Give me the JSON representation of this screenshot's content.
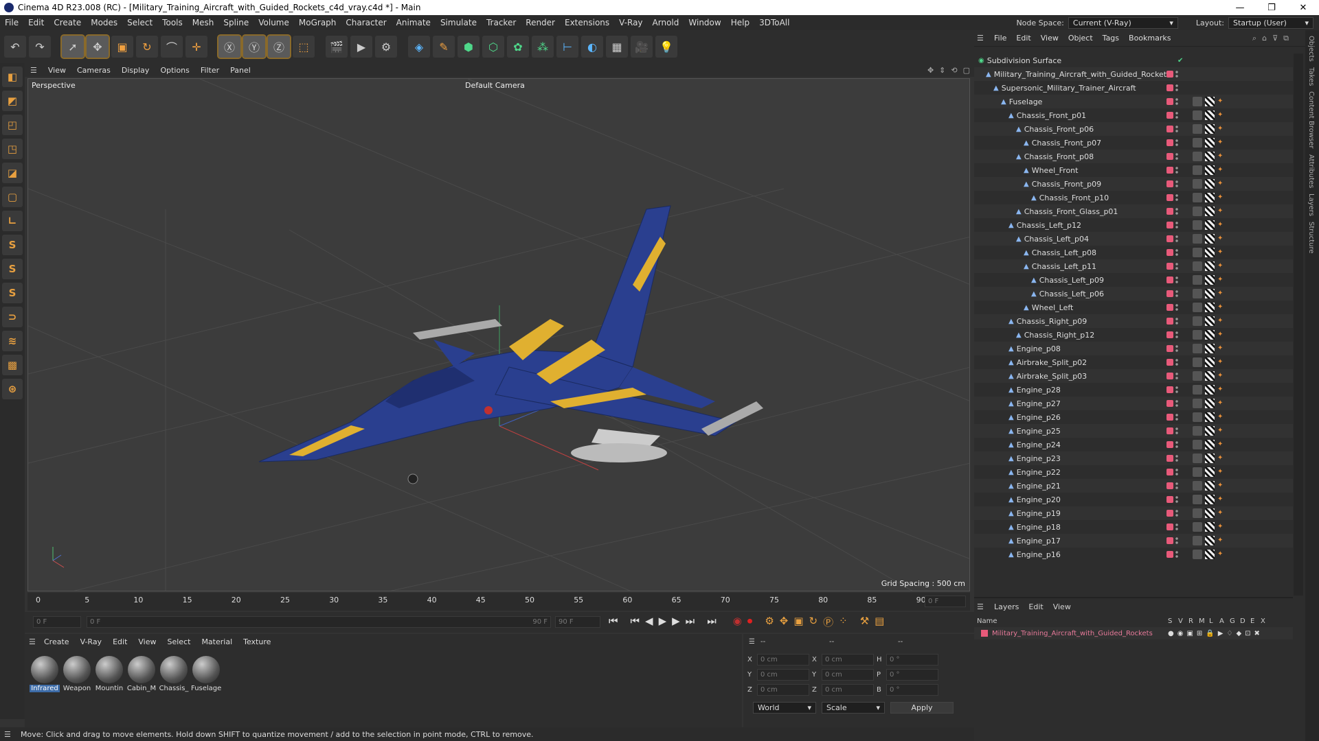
{
  "titlebar": {
    "title": "Cinema 4D R23.008 (RC) - [Military_Training_Aircraft_with_Guided_Rockets_c4d_vray.c4d *] - Main",
    "min": "—",
    "max": "❐",
    "close": "✕"
  },
  "menubar": {
    "items": [
      "File",
      "Edit",
      "Create",
      "Modes",
      "Select",
      "Tools",
      "Mesh",
      "Spline",
      "Volume",
      "MoGraph",
      "Character",
      "Animate",
      "Simulate",
      "Tracker",
      "Render",
      "Extensions",
      "V-Ray",
      "Arnold",
      "Window",
      "Help",
      "3DToAll"
    ],
    "node_space_label": "Node Space:",
    "node_space_value": "Current (V-Ray)",
    "layout_label": "Layout:",
    "layout_value": "Startup (User)"
  },
  "viewport": {
    "menu": [
      "View",
      "Cameras",
      "Display",
      "Options",
      "Filter",
      "Panel"
    ],
    "label": "Perspective",
    "camera": "Default Camera",
    "grid_spacing": "Grid Spacing : 500 cm"
  },
  "timeline": {
    "ticks": [
      "0",
      "5",
      "10",
      "15",
      "20",
      "25",
      "30",
      "35",
      "40",
      "45",
      "50",
      "55",
      "60",
      "65",
      "70",
      "75",
      "80",
      "85",
      "90"
    ],
    "current_frame": "0 F"
  },
  "playbar": {
    "start": "0 F",
    "range_start": "0 F",
    "range_end": "90 F",
    "end": "90 F"
  },
  "materials": {
    "menu": [
      "Create",
      "V-Ray",
      "Edit",
      "View",
      "Select",
      "Material",
      "Texture"
    ],
    "items": [
      {
        "name": "Infrared",
        "selected": true
      },
      {
        "name": "Weapon",
        "selected": false
      },
      {
        "name": "Mountin",
        "selected": false
      },
      {
        "name": "Cabin_M",
        "selected": false
      },
      {
        "name": "Chassis_",
        "selected": false
      },
      {
        "name": "Fuselage",
        "selected": false
      }
    ]
  },
  "attributes": {
    "headers": [
      "--",
      "--",
      "--"
    ],
    "rows": [
      {
        "a": "X",
        "av": "0 cm",
        "b": "X",
        "bv": "0 cm",
        "c": "H",
        "cv": "0 °"
      },
      {
        "a": "Y",
        "av": "0 cm",
        "b": "Y",
        "bv": "0 cm",
        "c": "P",
        "cv": "0 °"
      },
      {
        "a": "Z",
        "av": "0 cm",
        "b": "Z",
        "bv": "0 cm",
        "c": "B",
        "cv": "0 °"
      }
    ],
    "coord": "World",
    "mode": "Scale",
    "apply": "Apply"
  },
  "status": "Move: Click and drag to move elements. Hold down SHIFT to quantize movement / add to the selection in point mode, CTRL to remove.",
  "objects": {
    "menu": [
      "File",
      "Edit",
      "View",
      "Object",
      "Tags",
      "Bookmarks"
    ],
    "rows": [
      {
        "name": "Subdivision Surface",
        "depth": 0
      },
      {
        "name": "Military_Training_Aircraft_with_Guided_Rockets",
        "depth": 1
      },
      {
        "name": "Supersonic_Military_Trainer_Aircraft",
        "depth": 2
      },
      {
        "name": "Fuselage",
        "depth": 3
      },
      {
        "name": "Chassis_Front_p01",
        "depth": 4
      },
      {
        "name": "Chassis_Front_p06",
        "depth": 5
      },
      {
        "name": "Chassis_Front_p07",
        "depth": 6
      },
      {
        "name": "Chassis_Front_p08",
        "depth": 5
      },
      {
        "name": "Wheel_Front",
        "depth": 6
      },
      {
        "name": "Chassis_Front_p09",
        "depth": 6
      },
      {
        "name": "Chassis_Front_p10",
        "depth": 7
      },
      {
        "name": "Chassis_Front_Glass_p01",
        "depth": 5
      },
      {
        "name": "Chassis_Left_p12",
        "depth": 4
      },
      {
        "name": "Chassis_Left_p04",
        "depth": 5
      },
      {
        "name": "Chassis_Left_p08",
        "depth": 6
      },
      {
        "name": "Chassis_Left_p11",
        "depth": 6
      },
      {
        "name": "Chassis_Left_p09",
        "depth": 7
      },
      {
        "name": "Chassis_Left_p06",
        "depth": 7
      },
      {
        "name": "Wheel_Left",
        "depth": 6
      },
      {
        "name": "Chassis_Right_p09",
        "depth": 4
      },
      {
        "name": "Chassis_Right_p12",
        "depth": 5
      },
      {
        "name": "Engine_p08",
        "depth": 4
      },
      {
        "name": "Airbrake_Split_p02",
        "depth": 4
      },
      {
        "name": "Airbrake_Split_p03",
        "depth": 4
      },
      {
        "name": "Engine_p28",
        "depth": 4
      },
      {
        "name": "Engine_p27",
        "depth": 4
      },
      {
        "name": "Engine_p26",
        "depth": 4
      },
      {
        "name": "Engine_p25",
        "depth": 4
      },
      {
        "name": "Engine_p24",
        "depth": 4
      },
      {
        "name": "Engine_p23",
        "depth": 4
      },
      {
        "name": "Engine_p22",
        "depth": 4
      },
      {
        "name": "Engine_p21",
        "depth": 4
      },
      {
        "name": "Engine_p20",
        "depth": 4
      },
      {
        "name": "Engine_p19",
        "depth": 4
      },
      {
        "name": "Engine_p18",
        "depth": 4
      },
      {
        "name": "Engine_p17",
        "depth": 4
      },
      {
        "name": "Engine_p16",
        "depth": 4
      }
    ]
  },
  "layers": {
    "menu": [
      "Layers",
      "Edit",
      "View"
    ],
    "name_header": "Name",
    "flags": [
      "S",
      "V",
      "R",
      "M",
      "L",
      "A",
      "G",
      "D",
      "E",
      "X"
    ],
    "row": "Military_Training_Aircraft_with_Guided_Rockets"
  },
  "side_tabs": [
    "Objects",
    "Takes",
    "Content Browser",
    "Attributes",
    "Layers",
    "Structure"
  ]
}
